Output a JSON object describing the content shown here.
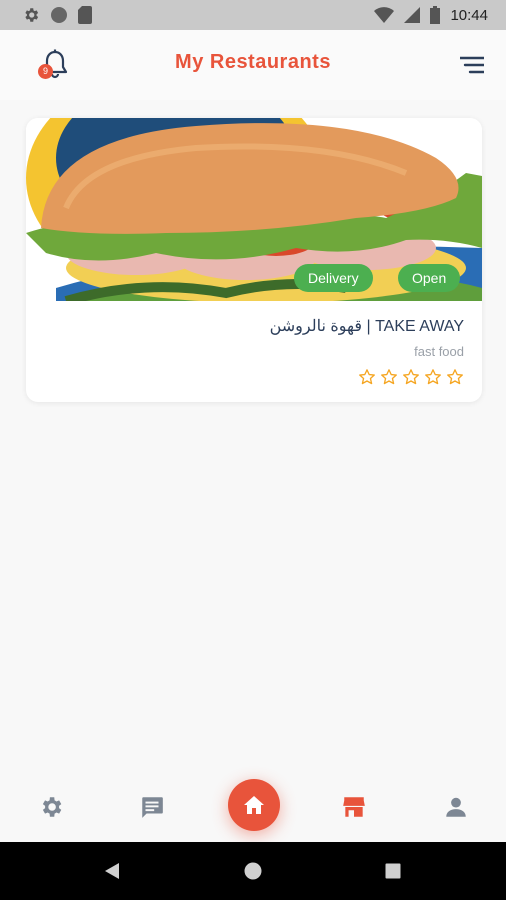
{
  "status_bar": {
    "time": "10:44"
  },
  "header": {
    "title": "My Restaurants",
    "notification_count": "9"
  },
  "restaurants": [
    {
      "name": "قهوة نالروشن | TAKE AWAY",
      "cuisine": "fast food",
      "tags": [
        "Delivery",
        "Open"
      ],
      "rating": 0,
      "rating_max": 5
    }
  ],
  "colors": {
    "accent": "#e8543b",
    "open_green": "#4caf50",
    "star": "#f5a623"
  },
  "bottom_nav": [
    {
      "icon": "settings-icon"
    },
    {
      "icon": "chat-icon"
    },
    {
      "icon": "home-icon"
    },
    {
      "icon": "store-icon"
    },
    {
      "icon": "profile-icon"
    }
  ]
}
